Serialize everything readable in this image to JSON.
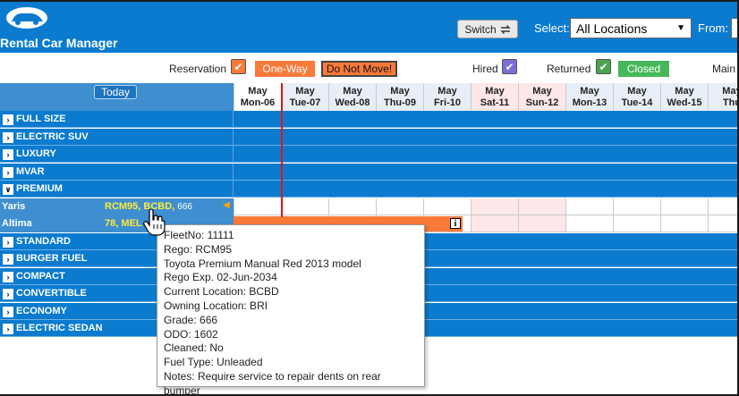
{
  "app": {
    "title": "Rental Car Manager"
  },
  "toolbar": {
    "switch_label": "Switch",
    "select_label": "Select:",
    "location_value": "All Locations",
    "from_label": "From:"
  },
  "legend": {
    "reservation": "Reservation",
    "one_way": "One-Way",
    "do_not_move": "Do Not Move!",
    "hired": "Hired",
    "returned": "Returned",
    "closed": "Closed",
    "main": "Main",
    "colors": {
      "reservation": "#fb7a3a",
      "hired": "#7a6fd6",
      "returned": "#4aa34f",
      "closed": "#47b85a"
    }
  },
  "grid": {
    "today_label": "Today",
    "days": [
      {
        "month": "May",
        "day": "Mon-06",
        "weekend": false
      },
      {
        "month": "May",
        "day": "Tue-07",
        "weekend": false
      },
      {
        "month": "May",
        "day": "Wed-08",
        "weekend": false
      },
      {
        "month": "May",
        "day": "Thu-09",
        "weekend": false
      },
      {
        "month": "May",
        "day": "Fri-10",
        "weekend": false
      },
      {
        "month": "May",
        "day": "Sat-11",
        "weekend": true
      },
      {
        "month": "May",
        "day": "Sun-12",
        "weekend": true
      },
      {
        "month": "May",
        "day": "Mon-13",
        "weekend": false
      },
      {
        "month": "May",
        "day": "Tue-14",
        "weekend": false
      },
      {
        "month": "May",
        "day": "Wed-15",
        "weekend": false
      },
      {
        "month": "May",
        "day": "Thu",
        "weekend": false
      }
    ],
    "categories_top": [
      {
        "label": "FULL SIZE",
        "expanded": false
      },
      {
        "label": "ELECTRIC SUV",
        "expanded": false
      },
      {
        "label": "LUXURY",
        "expanded": false
      },
      {
        "label": "MVAR",
        "expanded": false
      },
      {
        "label": "PREMIUM",
        "expanded": true
      }
    ],
    "cars": [
      {
        "model": "Yaris",
        "rego": "RCM95, BCBD,",
        "grade": "666"
      },
      {
        "model": "Altima",
        "rego": "78, MEL",
        "grade": ""
      }
    ],
    "categories_bottom": [
      {
        "label": "STANDARD",
        "expanded": false
      },
      {
        "label": "BURGER FUEL",
        "expanded": false
      },
      {
        "label": "COMPACT",
        "expanded": false
      },
      {
        "label": "CONVERTIBLE",
        "expanded": false
      },
      {
        "label": "ECONOMY",
        "expanded": false
      },
      {
        "label": "ELECTRIC SEDAN",
        "expanded": false
      }
    ]
  },
  "tooltip": {
    "lines": [
      "FleetNo: 11111",
      "Rego: RCM95",
      "Toyota Premium Manual Red 2013 model",
      "Rego Exp. 02-Jun-2034",
      "Current Location: BCBD",
      "Owning Location: BRI",
      "Grade: 666",
      "ODO: 1602",
      "Cleaned: No",
      "Fuel Type: Unleaded",
      "Notes: Require service to repair dents on rear bumper"
    ]
  }
}
